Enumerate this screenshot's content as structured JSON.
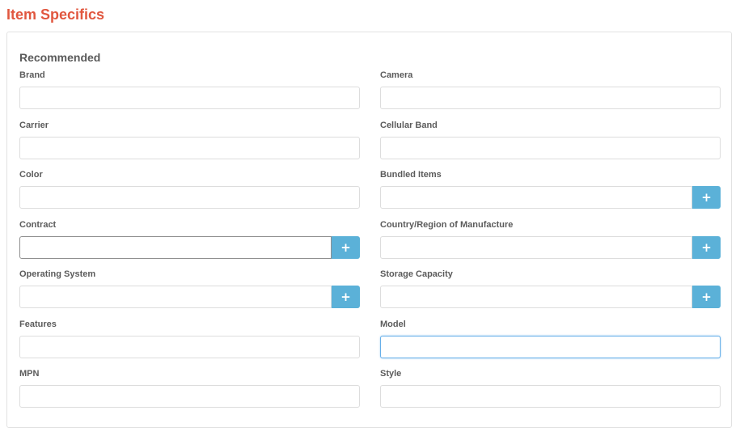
{
  "page": {
    "title": "Item Specifics",
    "accent_color": "#e1573f",
    "button_color": "#5bb1d8"
  },
  "panel": {
    "section_title": "Recommended"
  },
  "fields": {
    "brand": {
      "label": "Brand",
      "value": ""
    },
    "camera": {
      "label": "Camera",
      "value": ""
    },
    "carrier": {
      "label": "Carrier",
      "value": ""
    },
    "cellular_band": {
      "label": "Cellular Band",
      "value": ""
    },
    "color": {
      "label": "Color",
      "value": ""
    },
    "bundled_items": {
      "label": "Bundled Items",
      "value": "",
      "button_icon": "+"
    },
    "contract": {
      "label": "Contract",
      "value": "",
      "button_icon": "+"
    },
    "country_region": {
      "label": "Country/Region of Manufacture",
      "value": "",
      "button_icon": "+"
    },
    "operating_system": {
      "label": "Operating System",
      "value": "",
      "button_icon": "+"
    },
    "storage_capacity": {
      "label": "Storage Capacity",
      "value": "",
      "button_icon": "+"
    },
    "features": {
      "label": "Features",
      "value": ""
    },
    "model": {
      "label": "Model",
      "value": ""
    },
    "mpn": {
      "label": "MPN",
      "value": ""
    },
    "style": {
      "label": "Style",
      "value": ""
    }
  },
  "icons": {
    "add_button_icon": "plus-icon"
  }
}
